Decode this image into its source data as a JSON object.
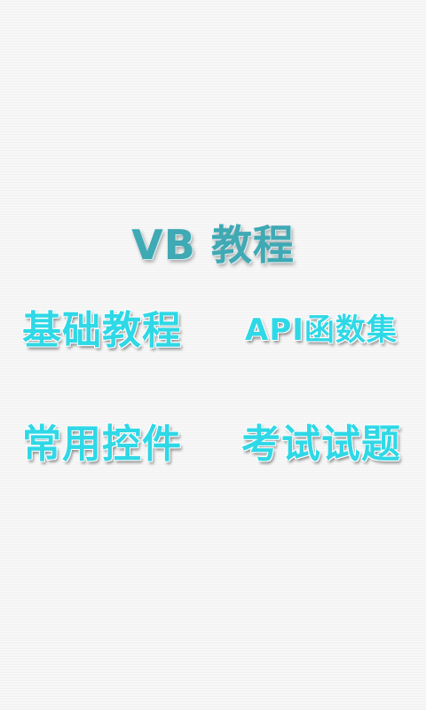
{
  "app": {
    "title": "VB 教程"
  },
  "menu": {
    "items": [
      {
        "label": "基础教程"
      },
      {
        "label": "API函数集"
      },
      {
        "label": "常用控件"
      },
      {
        "label": "考试试题"
      }
    ]
  },
  "colors": {
    "background": "#f7f7f7",
    "title_text": "#3fa9b4",
    "menu_text": "#2fd8e6"
  }
}
